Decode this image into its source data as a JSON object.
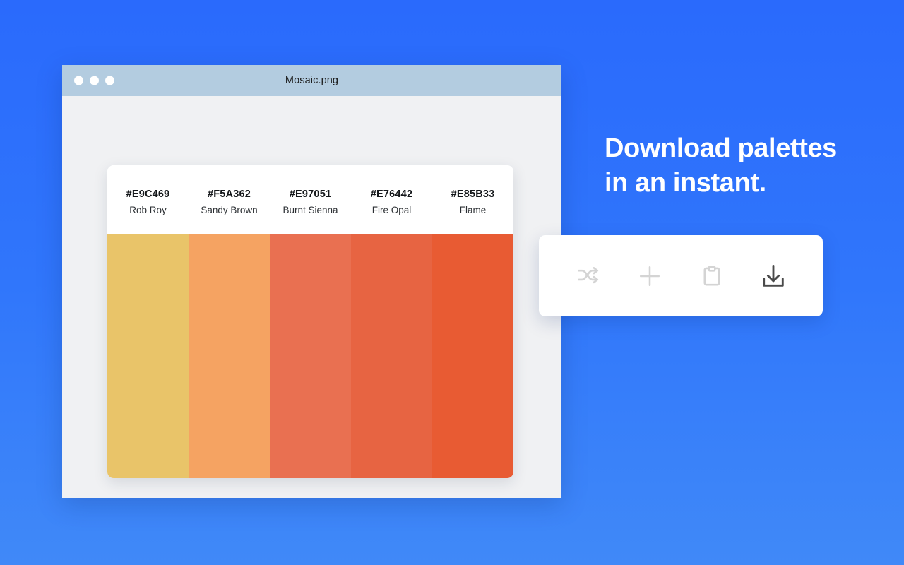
{
  "background": {
    "gradient_top": "#2A6AFC",
    "gradient_bottom": "#4089F8"
  },
  "window": {
    "title": "Mosaic.png",
    "body_color": "#F0F1F3",
    "titlebar_color": "#B3CCE0",
    "traffic_lights": [
      "close",
      "minimize",
      "zoom"
    ]
  },
  "palette": {
    "swatches": [
      {
        "hex": "#E9C469",
        "name": "Rob Roy"
      },
      {
        "hex": "#F5A362",
        "name": "Sandy Brown"
      },
      {
        "hex": "#E97051",
        "name": "Burnt Sienna"
      },
      {
        "hex": "#E76442",
        "name": "Fire Opal"
      },
      {
        "hex": "#E85B33",
        "name": "Flame"
      }
    ]
  },
  "headline": {
    "line1": "Download palettes",
    "line2": "in an instant."
  },
  "toolbar": {
    "buttons": [
      {
        "icon": "shuffle-icon",
        "label": "Shuffle",
        "color": "#D4D4D4"
      },
      {
        "icon": "plus-icon",
        "label": "Add",
        "color": "#D4D4D4"
      },
      {
        "icon": "clipboard-icon",
        "label": "Copy",
        "color": "#D4D4D4"
      },
      {
        "icon": "download-icon",
        "label": "Download",
        "color": "#4A4A4A"
      }
    ]
  }
}
